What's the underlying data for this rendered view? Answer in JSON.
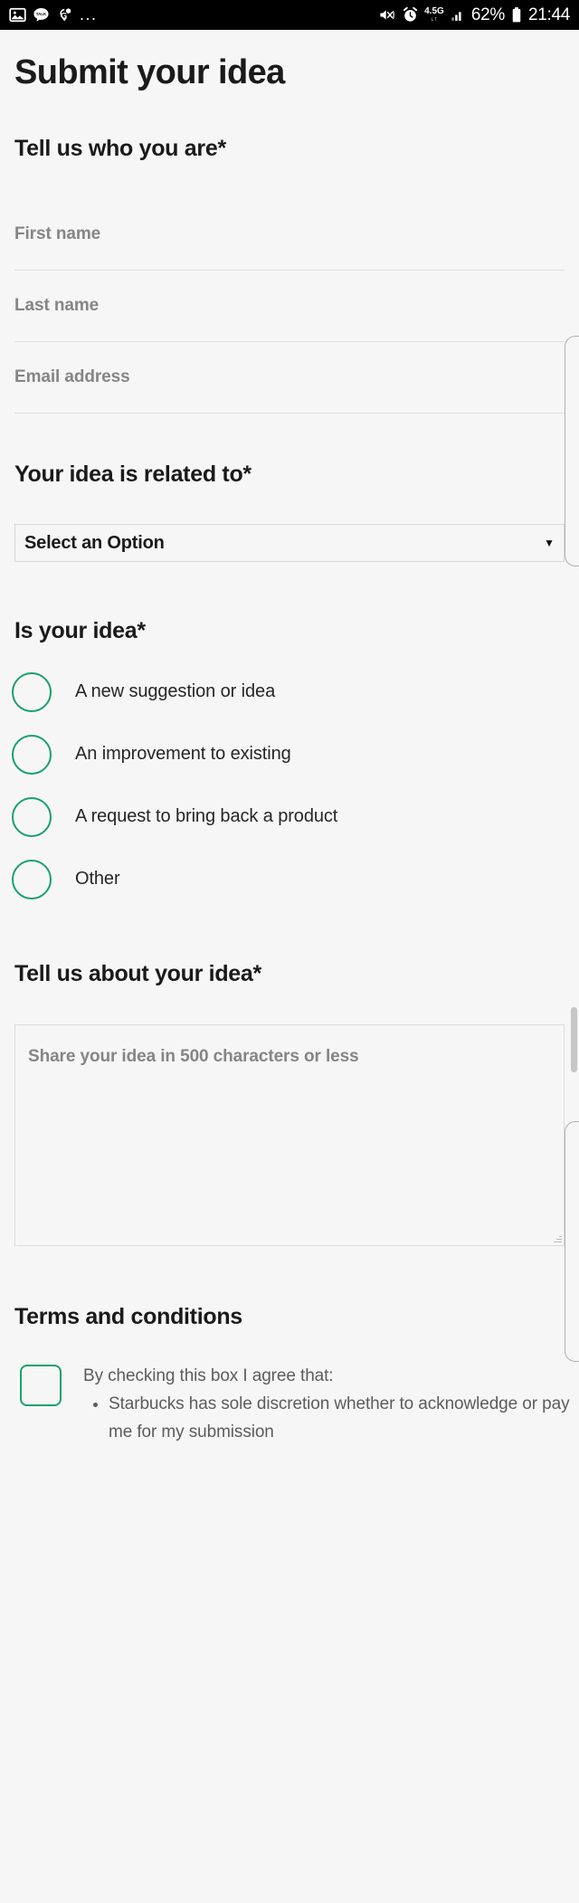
{
  "statusbar": {
    "left_icons": [
      "image-icon",
      "kakaotalk-icon",
      "maps-pin-icon"
    ],
    "overflow": "...",
    "mute_icon": "volume-mute-vibrate-icon",
    "alarm_icon": "alarm-clock-icon",
    "network_label": "4.5G",
    "network_arrows": "↓↑",
    "signal_icon": "signal-bars-icon",
    "battery_percent": "62%",
    "battery_icon": "battery-icon",
    "clock": "21:44"
  },
  "page": {
    "title": "Submit your idea"
  },
  "identity": {
    "heading": "Tell us who you are*",
    "fields": [
      {
        "name": "first-name",
        "placeholder": "First name",
        "value": ""
      },
      {
        "name": "last-name",
        "placeholder": "Last name",
        "value": ""
      },
      {
        "name": "email-address",
        "placeholder": "Email address",
        "value": ""
      }
    ]
  },
  "related_to": {
    "heading": "Your idea is related to*",
    "select": {
      "selected": "Select an Option",
      "caret": "▼"
    }
  },
  "idea_type": {
    "heading": "Is your idea*",
    "options": [
      "A new suggestion or idea",
      "An improvement to existing",
      "A request to bring back a product",
      "Other"
    ]
  },
  "about_idea": {
    "heading": "Tell us about your idea*",
    "textarea": {
      "placeholder": "Share your idea in 500 characters or less",
      "value": ""
    }
  },
  "terms": {
    "heading": "Terms and conditions",
    "checkbox_checked": false,
    "intro": "By checking this box I agree that:",
    "bullets": [
      "Starbucks has sole discretion whether to acknowledge or pay me for my submission"
    ]
  },
  "colors": {
    "page_bg": "#f6f6f6",
    "text": "#1a1a1a",
    "muted_text": "#858585",
    "accent_green": "#1aa06d",
    "rule": "#dedede",
    "statusbar_bg": "#000000"
  }
}
